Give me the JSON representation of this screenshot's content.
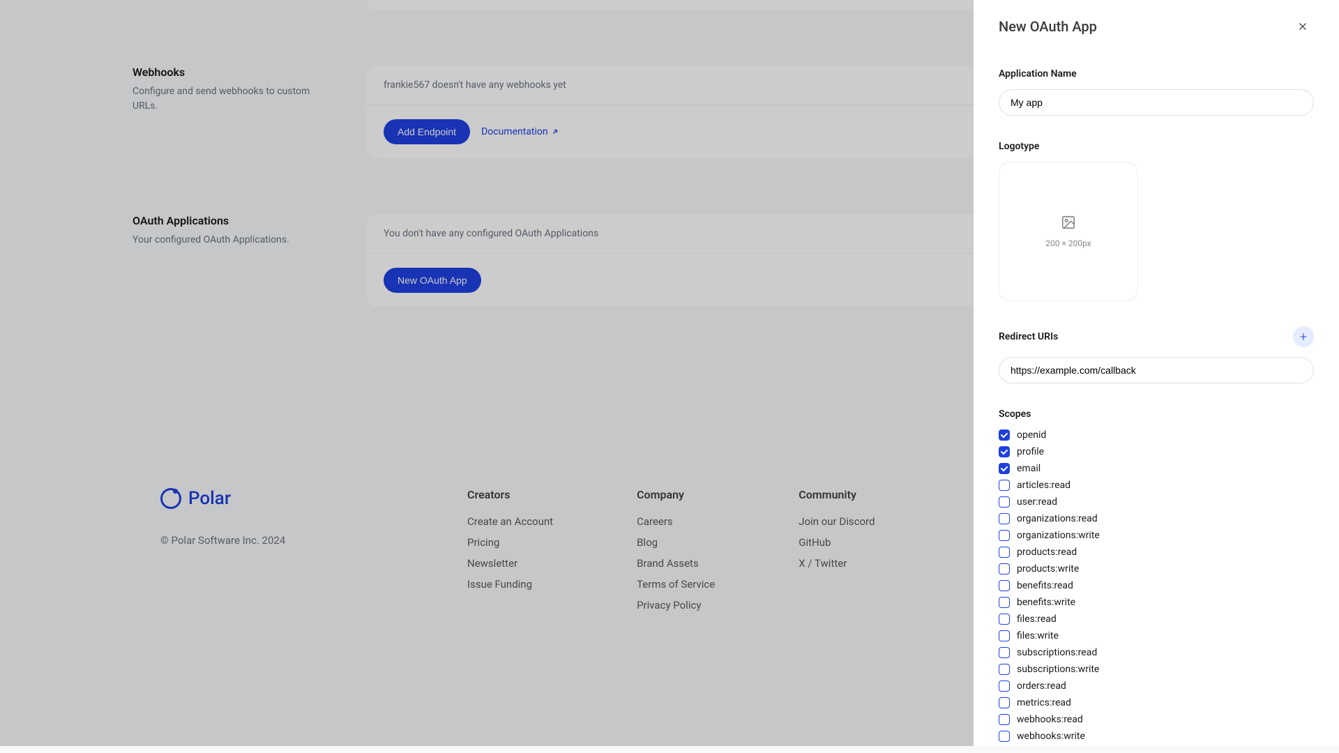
{
  "sections": {
    "webhooks": {
      "title": "Webhooks",
      "desc": "Configure and send webhooks to custom URLs.",
      "empty": "frankie567 doesn't have any webhooks yet",
      "btn": "Add Endpoint",
      "link": "Documentation"
    },
    "oauth": {
      "title": "OAuth Applications",
      "desc": "Your configured OAuth Applications.",
      "empty": "You don't have any configured OAuth Applications",
      "btn": "New OAuth App"
    }
  },
  "footer": {
    "brand": "Polar",
    "copyright": "© Polar Software Inc. 2024",
    "columns": [
      {
        "title": "Creators",
        "links": [
          "Create an Account",
          "Pricing",
          "Newsletter",
          "Issue Funding"
        ]
      },
      {
        "title": "Company",
        "links": [
          "Careers",
          "Blog",
          "Brand Assets",
          "Terms of Service",
          "Privacy Policy"
        ]
      },
      {
        "title": "Community",
        "links": [
          "Join our Discord",
          "GitHub",
          "X / Twitter"
        ]
      }
    ]
  },
  "drawer": {
    "title": "New OAuth App",
    "appName": {
      "label": "Application Name",
      "value": "My app"
    },
    "logotype": {
      "label": "Logotype",
      "hint": "200 × 200px"
    },
    "redirect": {
      "label": "Redirect URIs",
      "value": "https://example.com/callback"
    },
    "scopes": {
      "label": "Scopes",
      "items": [
        {
          "name": "openid",
          "checked": true
        },
        {
          "name": "profile",
          "checked": true
        },
        {
          "name": "email",
          "checked": true
        },
        {
          "name": "articles:read",
          "checked": false
        },
        {
          "name": "user:read",
          "checked": false
        },
        {
          "name": "organizations:read",
          "checked": false
        },
        {
          "name": "organizations:write",
          "checked": false
        },
        {
          "name": "products:read",
          "checked": false
        },
        {
          "name": "products:write",
          "checked": false
        },
        {
          "name": "benefits:read",
          "checked": false
        },
        {
          "name": "benefits:write",
          "checked": false
        },
        {
          "name": "files:read",
          "checked": false
        },
        {
          "name": "files:write",
          "checked": false
        },
        {
          "name": "subscriptions:read",
          "checked": false
        },
        {
          "name": "subscriptions:write",
          "checked": false
        },
        {
          "name": "orders:read",
          "checked": false
        },
        {
          "name": "metrics:read",
          "checked": false
        },
        {
          "name": "webhooks:read",
          "checked": false
        },
        {
          "name": "webhooks:write",
          "checked": false
        }
      ]
    }
  }
}
